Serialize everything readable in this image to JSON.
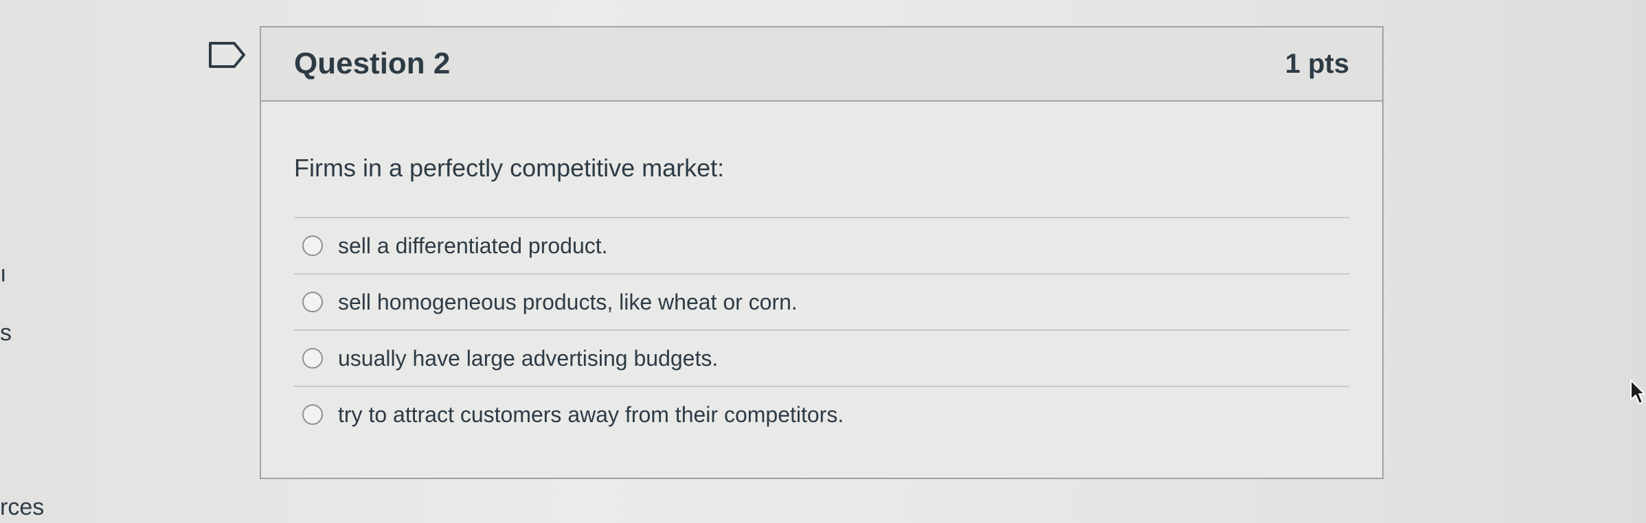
{
  "left_nav_fragments": [
    "ı",
    "s",
    "rces"
  ],
  "question": {
    "title": "Question 2",
    "points": "1 pts",
    "prompt": "Firms in a perfectly competitive market:",
    "answers": [
      {
        "label": "sell a differentiated product."
      },
      {
        "label": "sell homogeneous products, like wheat or corn."
      },
      {
        "label": "usually have large advertising budgets."
      },
      {
        "label": "try to attract customers away from their competitors."
      }
    ]
  },
  "icons": {
    "bookmark": "bookmark-flag-icon",
    "radio": "radio-button-icon",
    "cursor": "mouse-pointer-icon"
  },
  "colors": {
    "text": "#2d3b45",
    "border": "#9ea3a6",
    "header_bg": "#e1e1e0"
  }
}
